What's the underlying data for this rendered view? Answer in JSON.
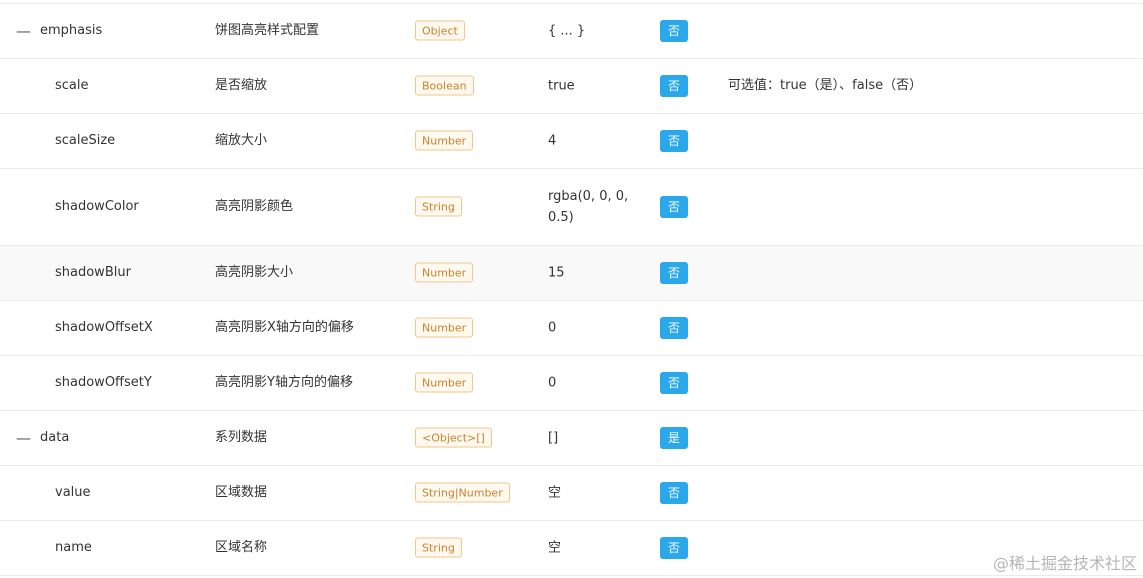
{
  "rows": [
    {
      "expander": "—",
      "name": "emphasis",
      "desc": "饼图高亮样式配置",
      "type": "Object",
      "default": "{ ... }",
      "required": "否",
      "note": ""
    },
    {
      "expander": "",
      "name": "scale",
      "desc": "是否缩放",
      "type": "Boolean",
      "default": "true",
      "required": "否",
      "note": "可选值：true（是）、false（否）"
    },
    {
      "expander": "",
      "name": "scaleSize",
      "desc": "缩放大小",
      "type": "Number",
      "default": "4",
      "required": "否",
      "note": ""
    },
    {
      "expander": "",
      "name": "shadowColor",
      "desc": "高亮阴影颜色",
      "type": "String",
      "default": "rgba(0, 0, 0, 0.5)",
      "required": "否",
      "note": ""
    },
    {
      "expander": "",
      "name": "shadowBlur",
      "desc": "高亮阴影大小",
      "type": "Number",
      "default": "15",
      "required": "否",
      "note": ""
    },
    {
      "expander": "",
      "name": "shadowOffsetX",
      "desc": "高亮阴影X轴方向的偏移",
      "type": "Number",
      "default": "0",
      "required": "否",
      "note": ""
    },
    {
      "expander": "",
      "name": "shadowOffsetY",
      "desc": "高亮阴影Y轴方向的偏移",
      "type": "Number",
      "default": "0",
      "required": "否",
      "note": ""
    },
    {
      "expander": "—",
      "name": "data",
      "desc": "系列数据",
      "type": "<Object>[]",
      "default": "[]",
      "required": "是",
      "note": ""
    },
    {
      "expander": "",
      "name": "value",
      "desc": "区域数据",
      "type": "String|Number",
      "default": "空",
      "required": "否",
      "note": ""
    },
    {
      "expander": "",
      "name": "name",
      "desc": "区域名称",
      "type": "String",
      "default": "空",
      "required": "否",
      "note": ""
    }
  ],
  "watermark": "@稀土掘金技术社区",
  "colors": {
    "badge": "#2aa8ea",
    "tag_border": "#f3c68a",
    "tag_text": "#c9832e",
    "row_border": "#ebebeb"
  }
}
